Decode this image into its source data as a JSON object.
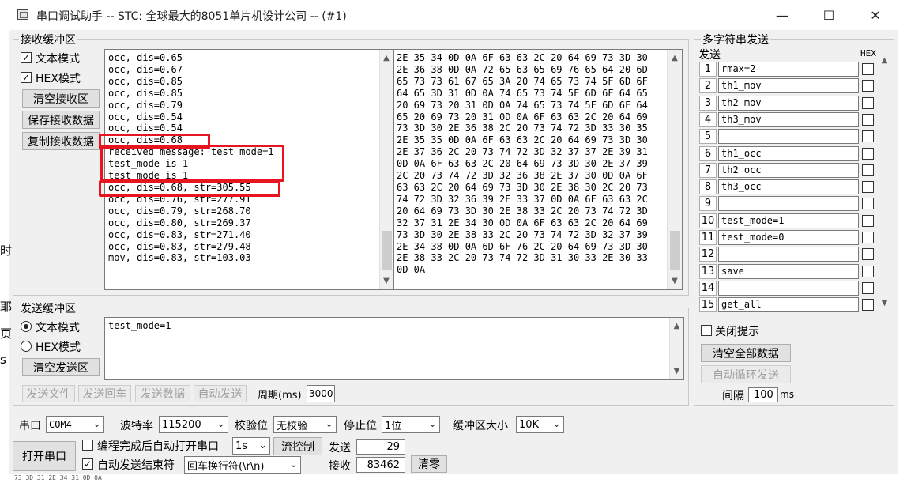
{
  "window": {
    "title": "串口调试助手 -- STC: 全球最大的8051单片机设计公司 -- (#1)",
    "minimize_glyph": "—",
    "maximize_glyph": "☐",
    "close_glyph": "✕"
  },
  "receive": {
    "group_label": "接收缓冲区",
    "text_mode_label": "文本模式",
    "hex_mode_label": "HEX模式",
    "text_mode_checked": true,
    "hex_mode_checked": true,
    "clear_button": "清空接收区",
    "save_button": "保存接收数据",
    "copy_button": "复制接收数据",
    "text_lines": [
      "occ, dis=0.65",
      "occ, dis=0.67",
      "occ, dis=0.85",
      "occ, dis=0.85",
      "occ, dis=0.79",
      "occ, dis=0.54",
      "occ, dis=0.54",
      "occ, dis=0.68",
      "received message: test_mode=1",
      "test_mode is 1",
      "test_mode is 1",
      "occ, dis=0.68, str=305.55",
      "occ, dis=0.76, str=277.91",
      "occ, dis=0.79, str=268.70",
      "occ, dis=0.80, str=269.37",
      "occ, dis=0.83, str=271.40",
      "occ, dis=0.83, str=279.48",
      "mov, dis=0.83, str=103.03"
    ],
    "hex_lines": [
      "2E 35 34 0D 0A 6F 63 63 2C 20 64 69 73 3D 30",
      "2E 36 38 0D 0A 72 65 63 65 69 76 65 64 20 6D",
      "65 73 73 61 67 65 3A 20 74 65 73 74 5F 6D 6F",
      "64 65 3D 31 0D 0A 74 65 73 74 5F 6D 6F 64 65",
      "20 69 73 20 31 0D 0A 74 65 73 74 5F 6D 6F 64",
      "65 20 69 73 20 31 0D 0A 6F 63 63 2C 20 64 69",
      "73 3D 30 2E 36 38 2C 20 73 74 72 3D 33 30 35",
      "2E 35 35 0D 0A 6F 63 63 2C 20 64 69 73 3D 30",
      "2E 37 36 2C 20 73 74 72 3D 32 37 37 2E 39 31",
      "0D 0A 6F 63 63 2C 20 64 69 73 3D 30 2E 37 39",
      "2C 20 73 74 72 3D 32 36 38 2E 37 30 0D 0A 6F",
      "63 63 2C 20 64 69 73 3D 30 2E 38 30 2C 20 73",
      "74 72 3D 32 36 39 2E 33 37 0D 0A 6F 63 63 2C",
      "20 64 69 73 3D 30 2E 38 33 2C 20 73 74 72 3D",
      "32 37 31 2E 34 30 0D 0A 6F 63 63 2C 20 64 69",
      "73 3D 30 2E 38 33 2C 20 73 74 72 3D 32 37 39",
      "2E 34 38 0D 0A 6D 6F 76 2C 20 64 69 73 3D 30",
      "2E 38 33 2C 20 73 74 72 3D 31 30 33 2E 30 33",
      "0D 0A"
    ]
  },
  "send": {
    "group_label": "发送缓冲区",
    "text_mode_label": "文本模式",
    "hex_mode_label": "HEX模式",
    "selected_mode": "text",
    "clear_button": "清空发送区",
    "content": "test_mode=1",
    "send_file_button": "发送文件",
    "send_enter_button": "发送回车",
    "send_data_button": "发送数据",
    "auto_send_button": "自动发送",
    "period_label": "周期(ms)",
    "period_value": "3000"
  },
  "multi_string": {
    "group_label": "多字符串发送",
    "send_header": "发送",
    "hex_header": "HEX",
    "rows": [
      {
        "num": "1",
        "value": "rmax=2"
      },
      {
        "num": "2",
        "value": "th1_mov"
      },
      {
        "num": "3",
        "value": "th2_mov"
      },
      {
        "num": "4",
        "value": "th3_mov"
      },
      {
        "num": "5",
        "value": ""
      },
      {
        "num": "6",
        "value": "th1_occ"
      },
      {
        "num": "7",
        "value": "th2_occ"
      },
      {
        "num": "8",
        "value": "th3_occ"
      },
      {
        "num": "9",
        "value": ""
      },
      {
        "num": "10",
        "value": "test_mode=1"
      },
      {
        "num": "11",
        "value": "test_mode=0"
      },
      {
        "num": "12",
        "value": ""
      },
      {
        "num": "13",
        "value": "save"
      },
      {
        "num": "14",
        "value": ""
      },
      {
        "num": "15",
        "value": "get_all"
      }
    ],
    "close_hint_label": "关闭提示",
    "clear_all_button": "清空全部数据",
    "auto_loop_button": "自动循环发送",
    "interval_label": "间隔",
    "interval_value": "100",
    "interval_unit": "ms"
  },
  "port": {
    "port_label": "串口",
    "port_value": "COM4",
    "baud_label": "波特率",
    "baud_value": "115200",
    "parity_label": "校验位",
    "parity_value": "无校验",
    "stop_label": "停止位",
    "stop_value": "1位",
    "buffer_label": "缓冲区大小",
    "buffer_value": "10K",
    "open_button": "打开串口",
    "auto_open_label": "编程完成后自动打开串口",
    "auto_open_delay": "1s",
    "flow_button": "流控制",
    "send_count_label": "发送",
    "send_count": "29",
    "recv_count_label": "接收",
    "recv_count": "83462",
    "clear_count_button": "清零",
    "auto_end_label": "自动发送结束符",
    "auto_end_checked": true,
    "end_char_value": "回车换行符(\\r\\n)"
  },
  "background": {
    "left_fragments": [
      "时",
      "耶",
      "页",
      "s"
    ],
    "bottom_fragment": "73 3D 31 2E 34 31 0D 0A"
  }
}
